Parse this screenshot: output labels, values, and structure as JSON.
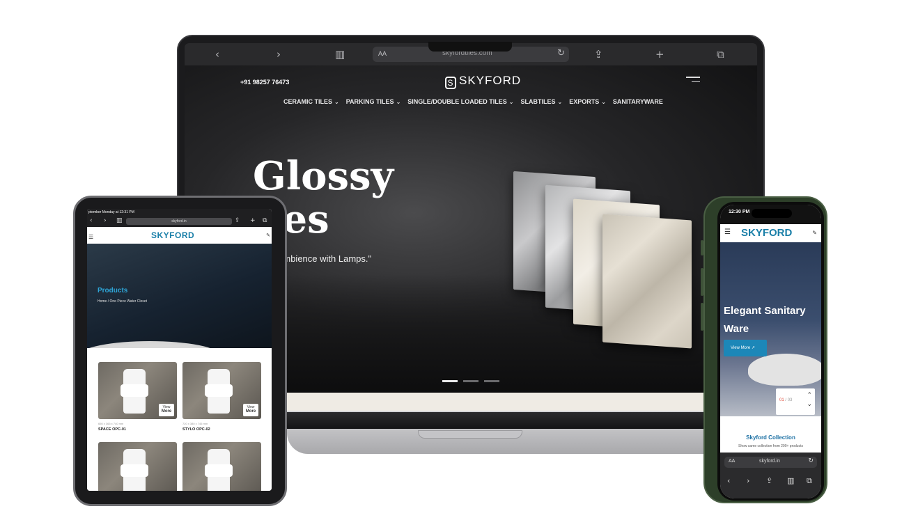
{
  "laptop": {
    "browser": {
      "aa_label": "AA",
      "domain": "skyfordtiles.com",
      "back_icon": "chevron-left",
      "forward_icon": "chevron-right",
      "bookmarks_icon": "book",
      "reload_icon": "reload",
      "share_icon": "share",
      "new_tab_icon": "plus",
      "tabs_icon": "tabs"
    },
    "header": {
      "phone": "+91 98257 76473",
      "logo": "SKYFORD",
      "logo_mark": "S"
    },
    "nav": [
      {
        "label": "CERAMIC TILES",
        "has_dropdown": true
      },
      {
        "label": "PARKING TILES",
        "has_dropdown": true
      },
      {
        "label": "SINGLE/DOUBLE LOADED TILES",
        "has_dropdown": true
      },
      {
        "label": "SLABTILES",
        "has_dropdown": true
      },
      {
        "label": "EXPORTS",
        "has_dropdown": true
      },
      {
        "label": "SANITARYWARE",
        "has_dropdown": false
      }
    ],
    "hero": {
      "title_line1": "Glossy",
      "title_line2": "iles",
      "subtitle": "ening Ambience with Lamps.\"",
      "slide_count": 3,
      "active_slide": 1
    }
  },
  "tablet": {
    "status": "ptember Monday at 12:31 PM",
    "url": "skyford.in",
    "aa_label": "AA",
    "logo": "SKYFORD",
    "hero": {
      "title": "Products",
      "breadcrumb": "Home / One Piece Water Closet"
    },
    "products": [
      {
        "name": "SPACE OPC-01",
        "dimensions": "650 x 365 x 740 mm",
        "more_top": "View",
        "more_bottom": "More"
      },
      {
        "name": "STYLO OPC-02",
        "dimensions": "720 x 380 x 745 mm",
        "more_top": "View",
        "more_bottom": "More"
      },
      {
        "name": "",
        "dimensions": "",
        "more_top": "",
        "more_bottom": ""
      },
      {
        "name": "",
        "dimensions": "",
        "more_top": "",
        "more_bottom": ""
      }
    ]
  },
  "phone": {
    "time": "12:30 PM",
    "logo": "SKYFORD",
    "hero": {
      "title_line1": "Elegant Sanitary",
      "title_line2": "Ware",
      "button": "View More ↗"
    },
    "counter": {
      "current": "01",
      "separator": "/",
      "total": "03"
    },
    "section": {
      "title": "Skyford Collection",
      "subtitle": "Show same collection from 200+ products"
    },
    "browser": {
      "aa_label": "AA",
      "domain": "skyford.in"
    }
  }
}
